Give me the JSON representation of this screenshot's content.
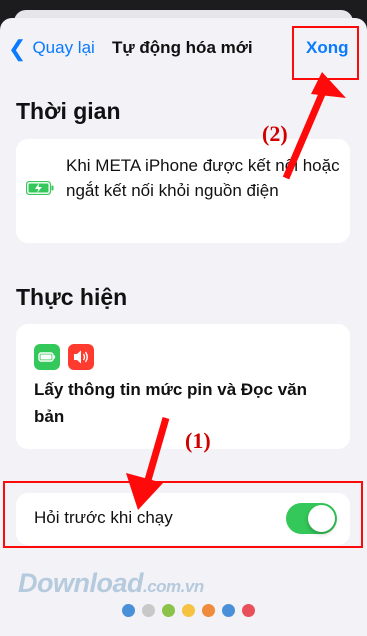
{
  "nav": {
    "back_label": "Quay lại",
    "title": "Tự động hóa mới",
    "done_label": "Xong"
  },
  "trigger": {
    "section_title": "Thời gian",
    "description": "Khi META iPhone được kết nối hoặc ngắt kết nối khỏi nguồn điện"
  },
  "action": {
    "section_title": "Thực hiện",
    "description": "Lấy thông tin mức pin và Đọc văn bản"
  },
  "ask_before_running": {
    "label": "Hỏi trước khi chạy",
    "enabled": true
  },
  "annotations": {
    "step1": "(1)",
    "step2": "(2)"
  },
  "watermark": {
    "brand": "Download",
    "suffix": ".com.vn"
  },
  "colors": {
    "accent": "#0a7aff",
    "toggle_on": "#34c759",
    "annotation": "#ff0a0a",
    "battery_icon_bg": "#34c759",
    "speaker_icon_bg": "#ff3b30"
  },
  "icons": [
    "chevron-left-icon",
    "battery-charging-icon",
    "battery-icon",
    "speaker-icon"
  ],
  "watermark_dot_colors": [
    "#4a90d9",
    "#c8c8c8",
    "#8bc34a",
    "#f5c242",
    "#f08a3c",
    "#4a90d9",
    "#e8505b"
  ]
}
